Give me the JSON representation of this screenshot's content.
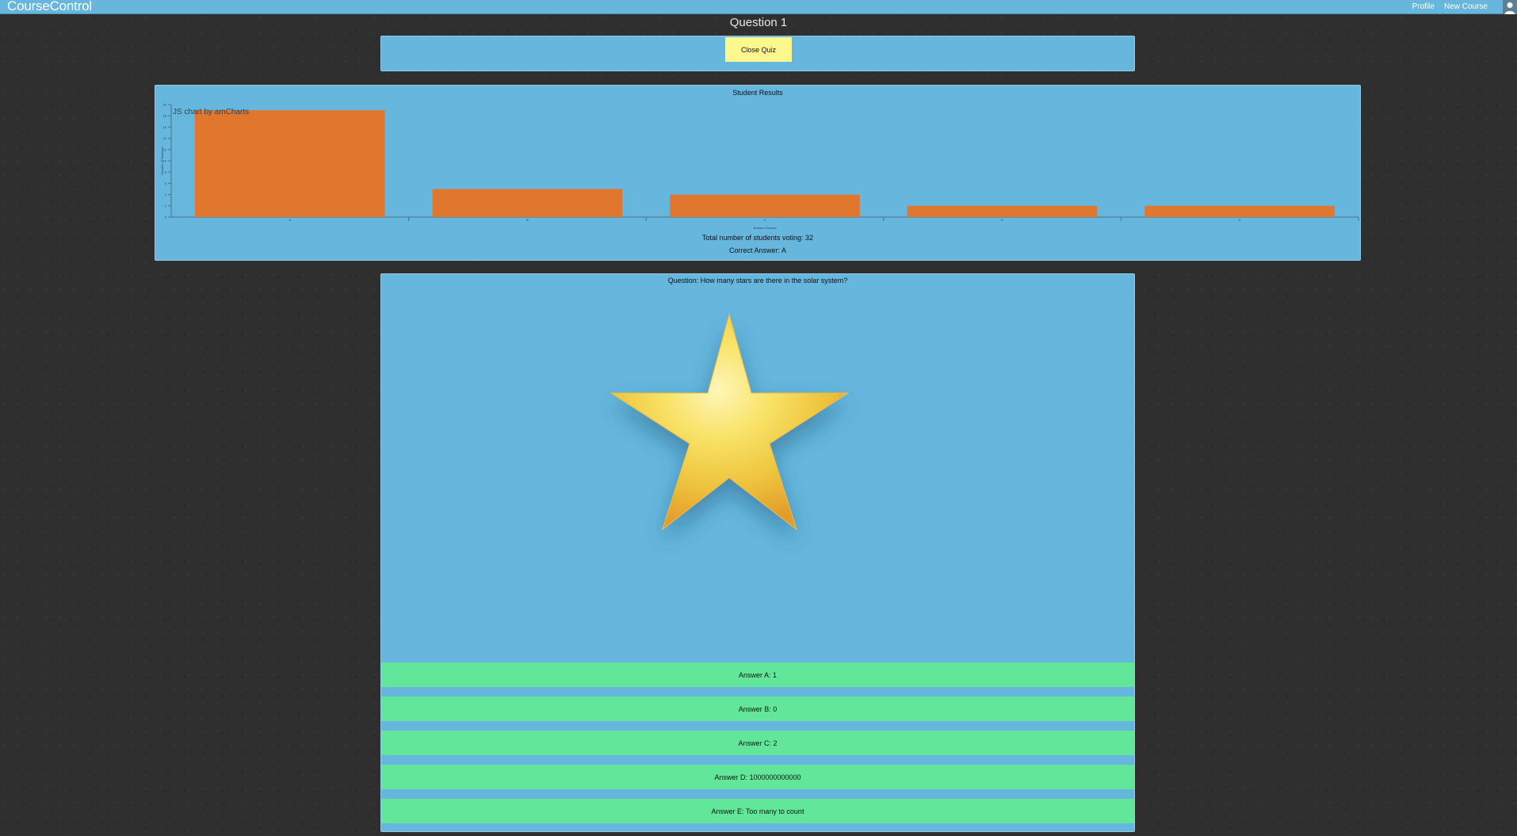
{
  "app": {
    "brand": "CourseControl",
    "nav": [
      "Profile",
      "New Course"
    ]
  },
  "page": {
    "title": "Question 1",
    "close_button": "Close Quiz"
  },
  "results": {
    "heading": "Student Results",
    "chart_credit": "JS chart by amCharts",
    "total": "Total number of students voting: 32",
    "correct": "Correct Answer: A"
  },
  "chart_data": {
    "type": "bar",
    "categories": [
      "A",
      "B",
      "C",
      "D",
      "E"
    ],
    "values": [
      19,
      5,
      4,
      2,
      2
    ],
    "ylabel": "Number of Students",
    "xlabel": "Answer Choices",
    "ylim": [
      0,
      20
    ],
    "grid": false,
    "colors": {
      "bar": "#e1772f",
      "axis": "#49738a"
    }
  },
  "question": {
    "text": "Question: How many stars are there in the solar system?",
    "image_icon": "star-icon",
    "answers": [
      "Answer A: 1",
      "Answer B: 0",
      "Answer C: 2",
      "Answer D: 1000000000000",
      "Answer E: Too many to count"
    ]
  }
}
